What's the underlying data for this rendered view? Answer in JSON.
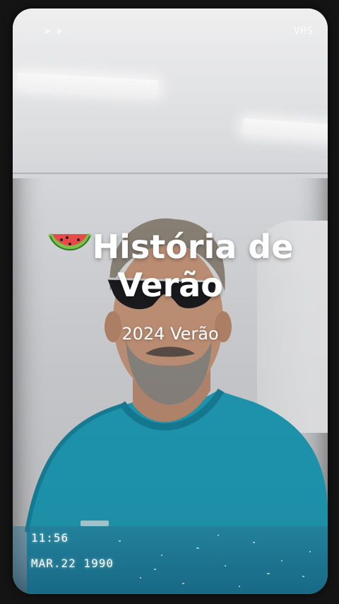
{
  "overlay": {
    "format_label": "VHS",
    "play_indicator": "▶ ▶"
  },
  "title": {
    "emoji": "watermelon-icon",
    "line1": "História de",
    "line2": "Verão"
  },
  "subtitle": "2024 Verão",
  "stamp": {
    "time": "11:56",
    "date": "MAR.22 1990"
  },
  "colors": {
    "shirt": "#1f9bb5",
    "text": "#ffffff",
    "band": "#1d6e8c"
  }
}
